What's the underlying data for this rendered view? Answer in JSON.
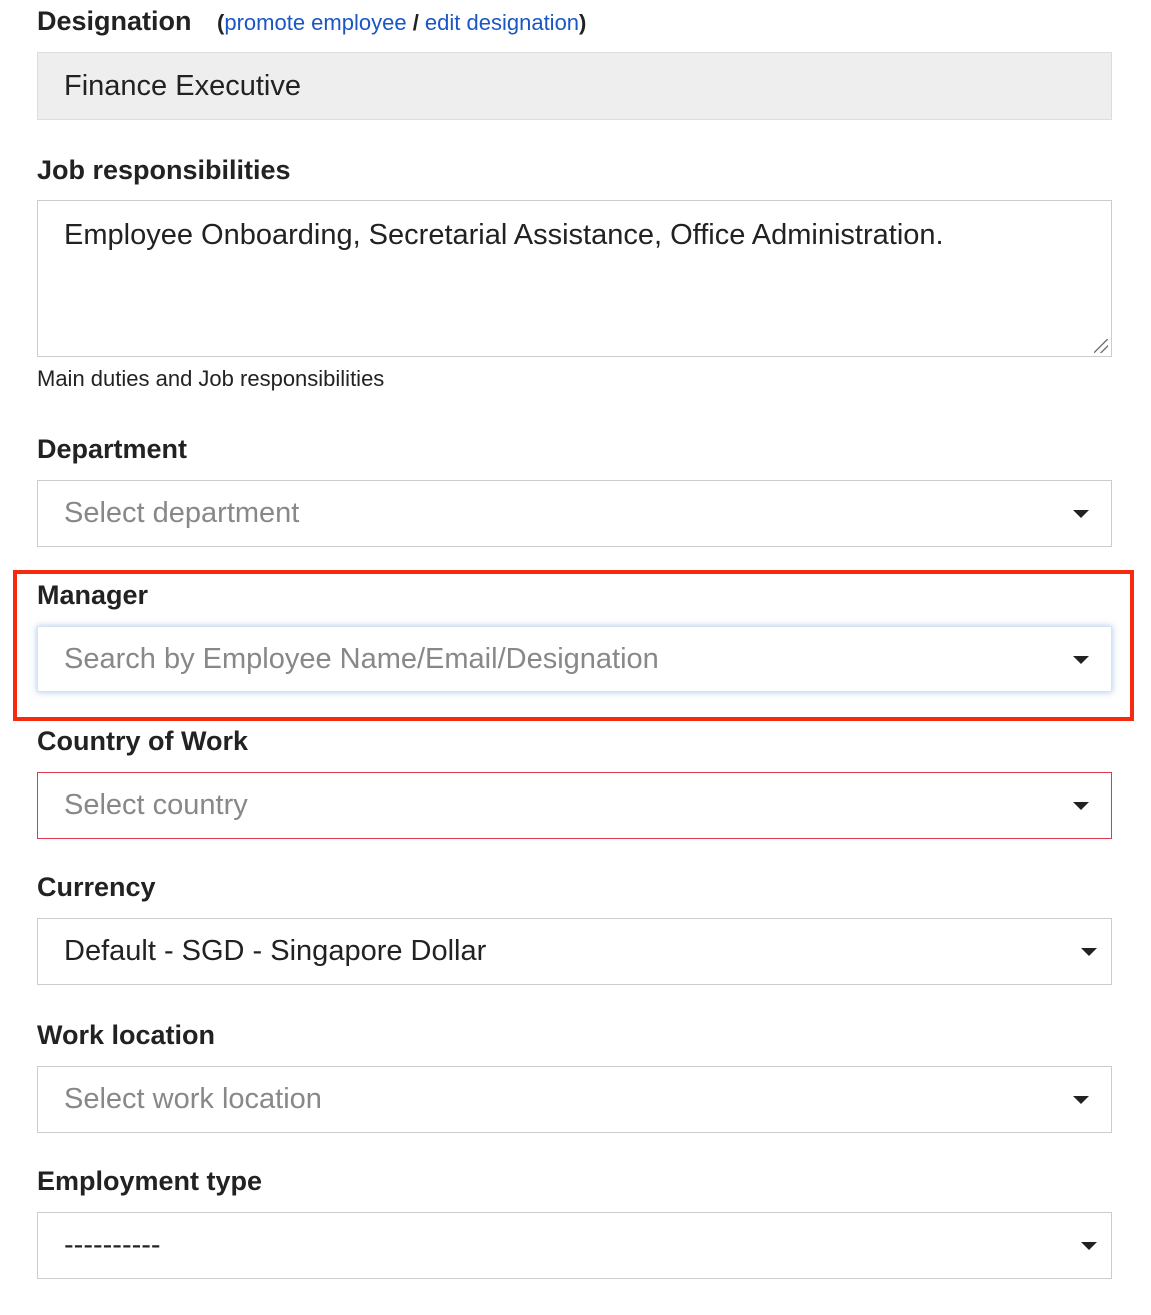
{
  "designation": {
    "label": "Designation",
    "open_paren": "(",
    "promote_link": "promote employee",
    "separator": " / ",
    "edit_link": "edit designation",
    "close_paren": ")",
    "value": "Finance Executive"
  },
  "job_responsibilities": {
    "label": "Job responsibilities",
    "value": "Employee Onboarding, Secretarial Assistance, Office Administration.",
    "help_text": "Main duties and Job responsibilities"
  },
  "department": {
    "label": "Department",
    "placeholder": "Select department"
  },
  "manager": {
    "label": "Manager",
    "placeholder": "Search by Employee Name/Email/Designation"
  },
  "country_of_work": {
    "label": "Country of Work",
    "placeholder": "Select country"
  },
  "currency": {
    "label": "Currency",
    "value": "Default - SGD - Singapore Dollar"
  },
  "work_location": {
    "label": "Work location",
    "placeholder": "Select work location"
  },
  "employment_type": {
    "label": "Employment type",
    "value": "----------"
  },
  "colors": {
    "link": "#1a56c4",
    "highlight_border": "#f7290e",
    "error_border": "#e0394c",
    "readonly_bg": "#eeeeee"
  },
  "icons": {
    "dropdown": "caret-down-icon",
    "resize": "resize-grip-icon"
  }
}
